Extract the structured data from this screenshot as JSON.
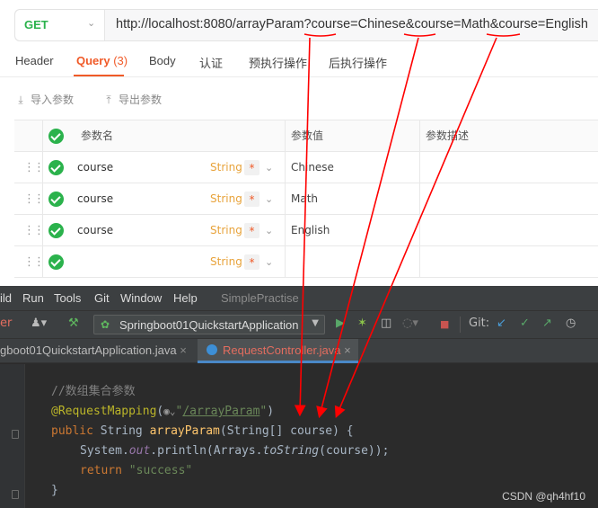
{
  "request": {
    "method": "GET",
    "url": "http://localhost:8080/arrayParam?course=Chinese&course=Math&course=English"
  },
  "tabs": [
    {
      "label": "Header"
    },
    {
      "label": "Query",
      "count": "(3)"
    },
    {
      "label": "Body"
    },
    {
      "label": "认证"
    },
    {
      "label": "预执行操作"
    },
    {
      "label": "后执行操作"
    }
  ],
  "tools": {
    "import": "导入参数",
    "export": "导出参数"
  },
  "params": {
    "headers": {
      "name": "参数名",
      "value": "参数值",
      "desc": "参数描述"
    },
    "rows": [
      {
        "name": "course",
        "type": "String",
        "required": "*",
        "value": "Chinese"
      },
      {
        "name": "course",
        "type": "String",
        "required": "*",
        "value": "Math"
      },
      {
        "name": "course",
        "type": "String",
        "required": "*",
        "value": "English"
      },
      {
        "name": "",
        "type": "String",
        "required": "*",
        "value": ""
      }
    ]
  },
  "ide": {
    "menus": [
      "ild",
      "Run",
      "Tools",
      "Git",
      "Window",
      "Help"
    ],
    "project": "SimplePractise",
    "toolbar": {
      "left_fragment": "er",
      "run_config": "Springboot01QuickstartApplication",
      "git_label": "Git:"
    },
    "editor_tabs": [
      {
        "label": "gboot01QuickstartApplication.java"
      },
      {
        "label": "RequestController.java"
      }
    ],
    "code": {
      "comment": "//数组集合参数",
      "anno": "@RequestMapping",
      "anno_path": "/arrayParam",
      "kw_public": "public",
      "type_string": "String",
      "method_name": "arrayParam",
      "param_type": "String[]",
      "param_name": "course",
      "system": "System.",
      "out": "out",
      "println": ".println(Arrays.",
      "to_string": "toString",
      "println_args": "(course));",
      "kw_return": "return",
      "ret_value": "\"success\"",
      "close_brace": "}"
    },
    "watermark": "CSDN @qh4hf10"
  },
  "colors": {
    "accent": "#f05a28",
    "get": "#2bb24c",
    "arrow": "#ff0000"
  }
}
